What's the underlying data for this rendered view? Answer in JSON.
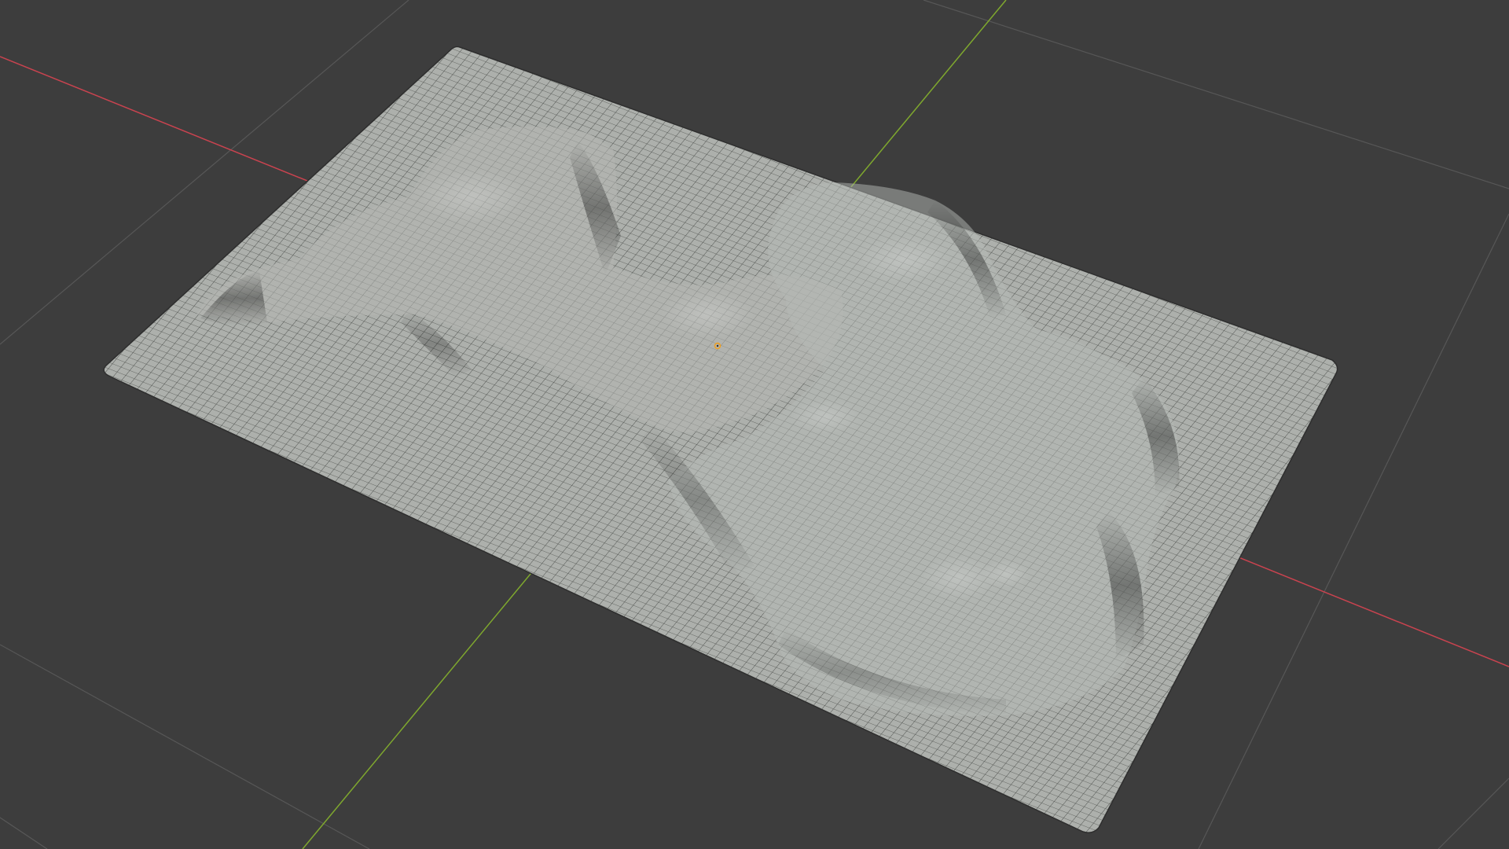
{
  "viewport": {
    "background_color": "#3d3d3d",
    "grid_line_color": "#5a5a5a",
    "x_axis_color": "#c9434f",
    "y_axis_color": "#7fa82e",
    "origin_marker_color": "#f0a020",
    "icons": [
      "origin-marker-icon"
    ]
  },
  "mesh": {
    "name": "terrain-mesh",
    "base_color": "#a9aca8",
    "wire_color": "#3f423f",
    "shading": "solid-with-wireframe"
  }
}
